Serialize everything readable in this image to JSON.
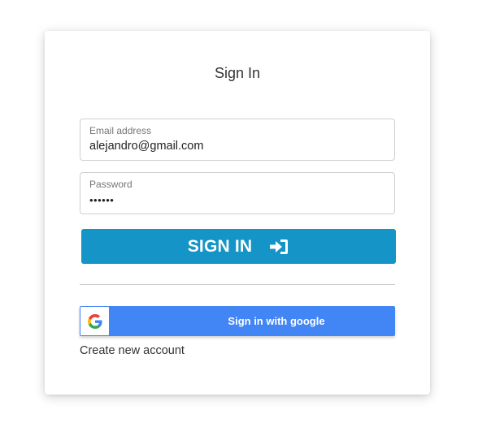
{
  "colors": {
    "accent": "#1494c7",
    "google_blue": "#4285f4",
    "card_background": "#ffffff"
  },
  "form": {
    "title": "Sign In",
    "email": {
      "label": "Email address",
      "value": "alejandro@gmail.com"
    },
    "password": {
      "label": "Password",
      "value": "••••••"
    },
    "signin_button": {
      "label": "SIGN IN",
      "icon": "sign-in-icon"
    },
    "google_button": {
      "label": "Sign in with google",
      "icon": "google-icon"
    },
    "create_account_link": "Create new account"
  }
}
